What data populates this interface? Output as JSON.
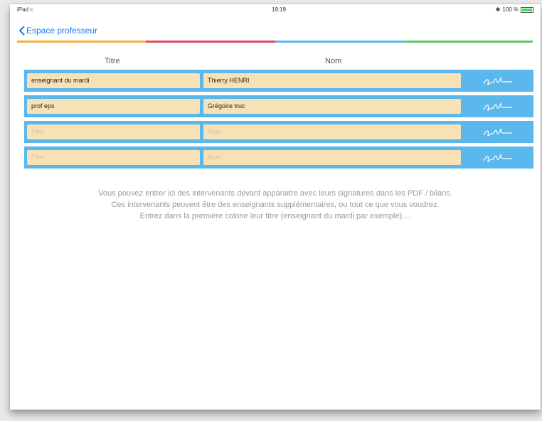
{
  "status": {
    "carrier": "iPad",
    "time": "19:19",
    "battery": "100 %"
  },
  "nav": {
    "back_label": "Espace professeur"
  },
  "colors": [
    "#f2b23a",
    "#e0475e",
    "#5ab8ec",
    "#63c56a"
  ],
  "table": {
    "headers": [
      "Titre",
      "Nom"
    ],
    "rows": [
      {
        "titre": "enseignant du mardi",
        "nom": "Thierry HENRI"
      },
      {
        "titre": "prof eps",
        "nom": "Grégoire truc"
      },
      {
        "titre": "Titre",
        "nom": "Nom"
      },
      {
        "titre": "Titre",
        "nom": "Nom"
      }
    ]
  },
  "info": {
    "line1": "Vous pouvez entrer ici des intervenants devant apparaitre avec leurs signatures dans les PDF / bilans.",
    "line2": "Ces intervenants peuvent être des enseignants supplémentaires, ou tout ce que vous voudrez.",
    "line3": "Entrez dans la première colone leur titre (enseignant du mardi par exemple)...."
  }
}
